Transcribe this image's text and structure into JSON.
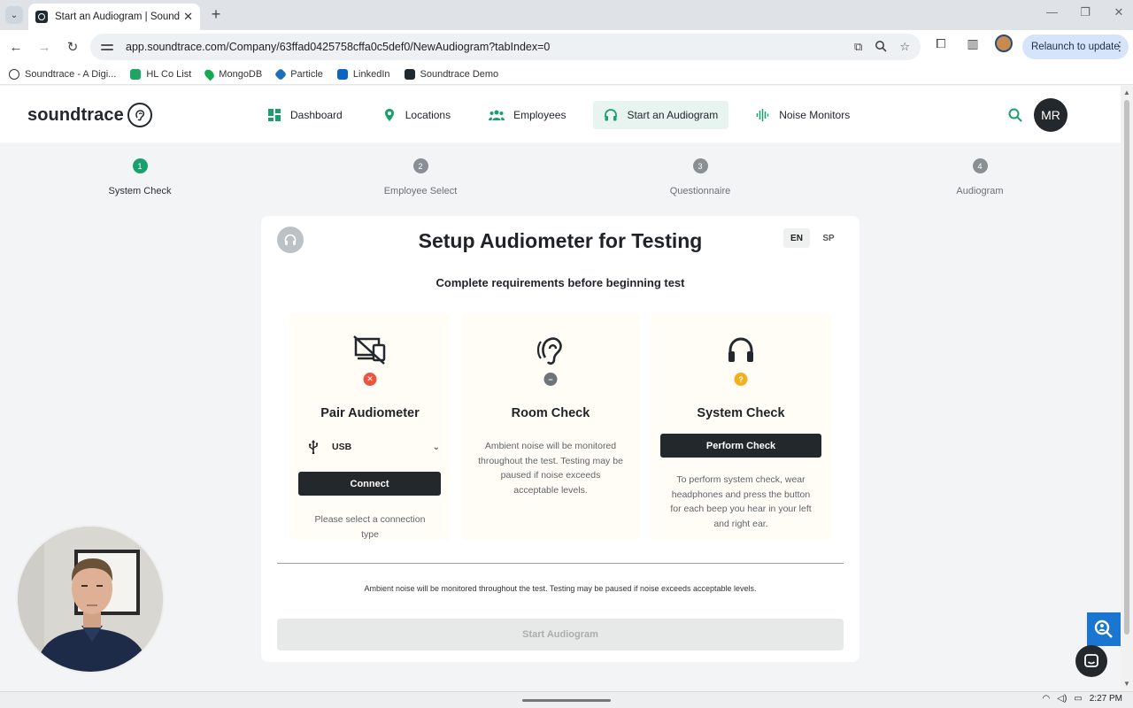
{
  "browser": {
    "tab_title": "Start an Audiogram | Soundtrac",
    "url": "app.soundtrace.com/Company/63ffad0425758cffa0c5def0/NewAudiogram?tabIndex=0",
    "relaunch_label": "Relaunch to update",
    "bookmarks": [
      {
        "label": "Soundtrace - A Digi...",
        "color": "#ffffff"
      },
      {
        "label": "HL Co List",
        "color": "#1fa463"
      },
      {
        "label": "MongoDB",
        "color": "#13aa52"
      },
      {
        "label": "Particle",
        "color": "#1c6fb8"
      },
      {
        "label": "LinkedIn",
        "color": "#0a66c2"
      },
      {
        "label": "Soundtrace Demo",
        "color": "#1e2a30"
      }
    ]
  },
  "app": {
    "logo": "soundtrace",
    "nav": [
      {
        "label": "Dashboard",
        "icon": "dashboard-icon"
      },
      {
        "label": "Locations",
        "icon": "location-pin-icon"
      },
      {
        "label": "Employees",
        "icon": "people-icon"
      },
      {
        "label": "Start an Audiogram",
        "icon": "headphones-icon",
        "active": true
      },
      {
        "label": "Noise Monitors",
        "icon": "waveform-icon"
      }
    ],
    "avatar_initials": "MR",
    "accent_color": "#1aa06d"
  },
  "stepper": [
    {
      "num": "1",
      "label": "System Check",
      "active": true
    },
    {
      "num": "2",
      "label": "Employee Select"
    },
    {
      "num": "3",
      "label": "Questionnaire"
    },
    {
      "num": "4",
      "label": "Audiogram"
    }
  ],
  "card": {
    "title": "Setup Audiometer for Testing",
    "subtitle": "Complete requirements before beginning test",
    "lang_en": "EN",
    "lang_sp": "SP",
    "panels": {
      "pair": {
        "title": "Pair Audiometer",
        "status": "error",
        "connection_type": "USB",
        "button": "Connect",
        "help": "Please select a connection type"
      },
      "room": {
        "title": "Room Check",
        "status": "neutral",
        "text": "Ambient noise will be monitored throughout the test. Testing may be paused if noise exceeds acceptable levels."
      },
      "system": {
        "title": "System Check",
        "status": "pending",
        "button": "Perform Check",
        "text": "To perform system check, wear headphones and press the button for each beep you hear in your left and right ear."
      }
    },
    "note": "Ambient noise will be monitored throughout the test. Testing may be paused if noise exceeds acceptable levels.",
    "start_button": "Start Audiogram"
  },
  "taskbar": {
    "time": "2:27 PM"
  }
}
